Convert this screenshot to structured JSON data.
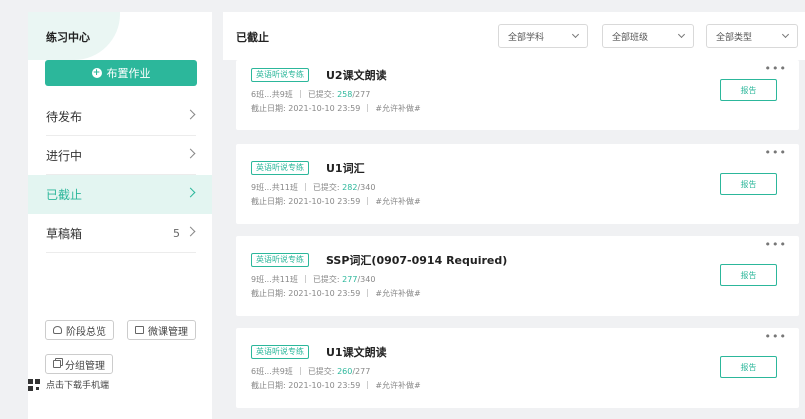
{
  "sidebar": {
    "title": "练习中心",
    "assign_button": "布置作业",
    "nav": [
      {
        "label": "待发布",
        "count": ""
      },
      {
        "label": "进行中",
        "count": ""
      },
      {
        "label": "已截止",
        "count": "",
        "active": true
      },
      {
        "label": "草稿箱",
        "count": "5"
      }
    ],
    "tools": {
      "stage_overview": "阶段总览",
      "micro_course": "微课管理",
      "group_manage": "分组管理",
      "download_app": "点击下载手机端"
    }
  },
  "header": {
    "title": "已截止",
    "filters": {
      "subject": "全部学科",
      "grade": "全部班级",
      "type": "全部类型"
    }
  },
  "cards": [
    {
      "tag": "英语听说专练",
      "title": "U2课文朗读",
      "classes": "6班...共9班",
      "submitted_label": "已提交:",
      "submitted": "258",
      "total": "/277",
      "deadline": "截止日期: 2021-10-10 23:59",
      "makeup": "#允许补做#",
      "report": "报告"
    },
    {
      "tag": "英语听说专练",
      "title": "U1词汇",
      "classes": "9班...共11班",
      "submitted_label": "已提交:",
      "submitted": "282",
      "total": "/340",
      "deadline": "截止日期: 2021-10-10 23:59",
      "makeup": "#允许补做#",
      "report": "报告"
    },
    {
      "tag": "英语听说专练",
      "title": "SSP词汇(0907-0914 Required)",
      "classes": "9班...共11班",
      "submitted_label": "已提交:",
      "submitted": "277",
      "total": "/340",
      "deadline": "截止日期: 2021-10-10 23:59",
      "makeup": "#允许补做#",
      "report": "报告"
    },
    {
      "tag": "英语听说专练",
      "title": "U1课文朗读",
      "classes": "6班...共9班",
      "submitted_label": "已提交:",
      "submitted": "260",
      "total": "/277",
      "deadline": "截止日期: 2021-10-10 23:59",
      "makeup": "#允许补做#",
      "report": "报告"
    }
  ],
  "more_glyph": "•••",
  "colors": {
    "accent": "#2cb79b",
    "active_bg": "#e3f5f1"
  }
}
